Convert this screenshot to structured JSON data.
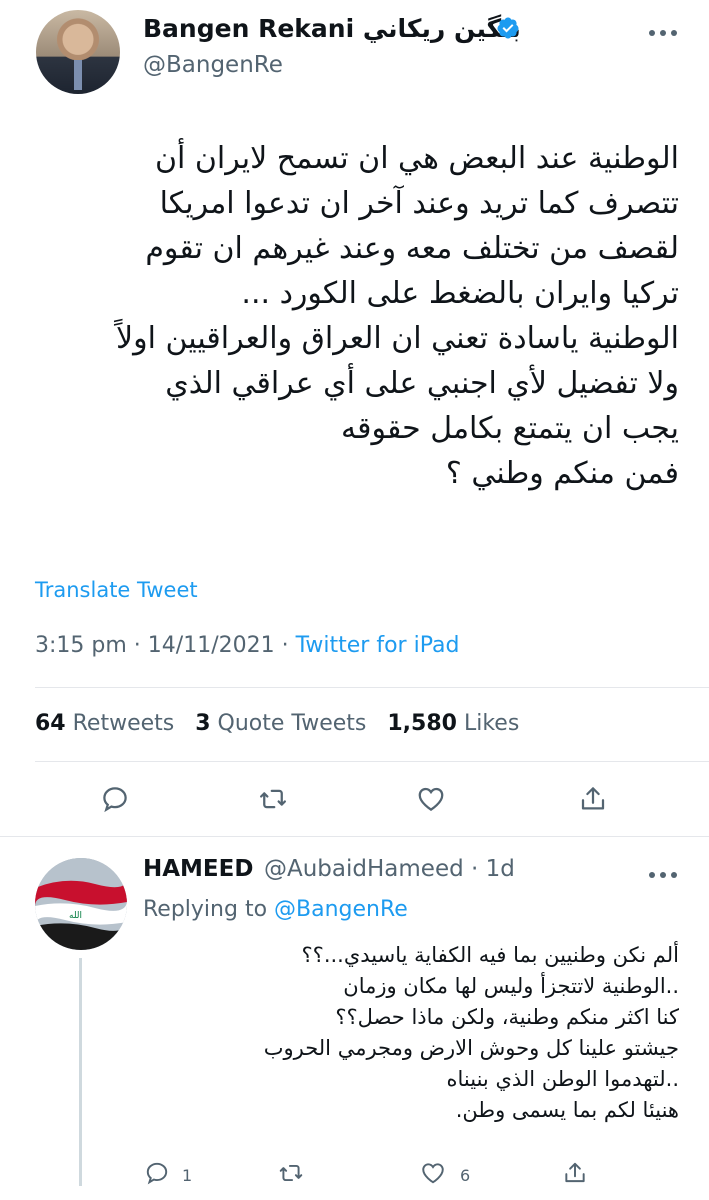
{
  "tweet": {
    "display_name": "Bangen Rekani بنگين ريكاني",
    "handle": "@BangenRe",
    "body_lines": [
      "الوطنية عند البعض هي ان تسمح لايران أن",
      "تتصرف كما تريد وعند آخر ان تدعوا امريكا",
      "لقصف من تختلف معه وعند غيرهم ان تقوم",
      "تركيا وايران بالضغط على الكورد ...",
      "الوطنية ياسادة تعني ان العراق والعراقيين اولاً",
      "ولا تفضيل لأي اجنبي على أي عراقي الذي",
      "يجب ان يتمتع بكامل حقوقه",
      "فمن منكم وطني ؟"
    ],
    "translate_label": "Translate Tweet",
    "time": "3:15 pm",
    "date": "14/11/2021",
    "source": "Twitter for iPad",
    "retweets_count": "64",
    "retweets_label": "Retweets",
    "quote_count": "3",
    "quote_label": "Quote Tweets",
    "likes_count": "1,580",
    "likes_label": "Likes"
  },
  "reply": {
    "name": "HAMEED",
    "handle": "@AubaidHameed",
    "age": "1d",
    "replying_prefix": "Replying to",
    "replying_to": "@BangenRe",
    "body_lines": [
      "ألم نكن وطنيين بما فيه الكفاية ياسيدي...؟؟",
      "..الوطنية لاتتجزأ وليس لها مكان وزمان",
      "كنا اكثر منكم وطنية، ولكن ماذا حصل؟؟",
      "جيشتو علينا كل وحوش الارض ومجرمي الحروب",
      "..لتهدموا الوطن الذي بنيناه",
      "هنيئا لكم بما يسمى وطن."
    ],
    "reply_count": "1",
    "like_count": "6"
  },
  "icons": {
    "verified": "verified-badge-icon",
    "more": "more-horizontal-icon",
    "reply": "reply-icon",
    "retweet": "retweet-icon",
    "like": "heart-icon",
    "share": "share-icon"
  },
  "colors": {
    "accent": "#1d9bf0",
    "secondary_text": "#536471",
    "text": "#0f1419"
  }
}
